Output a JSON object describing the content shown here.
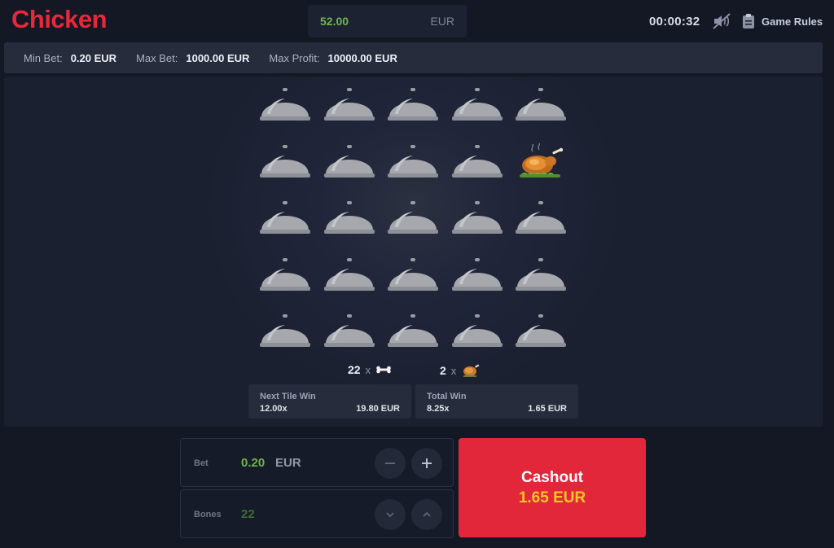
{
  "header": {
    "logo": "Chicken",
    "balance": "52.00",
    "currency": "EUR",
    "timer": "00:00:32",
    "mute_icon": "sound-off-icon",
    "rules_icon": "clipboard-icon",
    "rules_label": "Game Rules"
  },
  "infobar": {
    "min_bet_label": "Min Bet:",
    "min_bet_value": "0.20 EUR",
    "max_bet_label": "Max Bet:",
    "max_bet_value": "1000.00 EUR",
    "max_profit_label": "Max Profit:",
    "max_profit_value": "10000.00 EUR"
  },
  "board": {
    "rows": 5,
    "cols": 5,
    "tiles": [
      "cloche",
      "cloche",
      "cloche",
      "cloche",
      "cloche",
      "cloche",
      "cloche",
      "cloche",
      "cloche",
      "chicken",
      "cloche",
      "cloche",
      "cloche",
      "cloche",
      "cloche",
      "cloche",
      "cloche",
      "cloche",
      "cloche",
      "cloche",
      "cloche",
      "cloche",
      "cloche",
      "cloche",
      "cloche"
    ]
  },
  "counters": {
    "bones_count": "22",
    "bones_x": "x",
    "bones_icon": "bone-icon",
    "chicken_count": "2",
    "chicken_x": "x",
    "chicken_icon": "roast-chicken-icon"
  },
  "next_tile_win": {
    "title": "Next Tile Win",
    "multiplier": "12.00x",
    "amount": "19.80 EUR"
  },
  "total_win": {
    "title": "Total Win",
    "multiplier": "8.25x",
    "amount": "1.65 EUR"
  },
  "controls": {
    "bet_label": "Bet",
    "bet_value": "0.20",
    "bet_currency": "EUR",
    "bones_label": "Bones",
    "bones_value": "22",
    "colors": {
      "bet_value": "#6fb64a",
      "bones_value": "#3f6a35"
    }
  },
  "cashout": {
    "label": "Cashout",
    "amount": "1.65 EUR"
  }
}
